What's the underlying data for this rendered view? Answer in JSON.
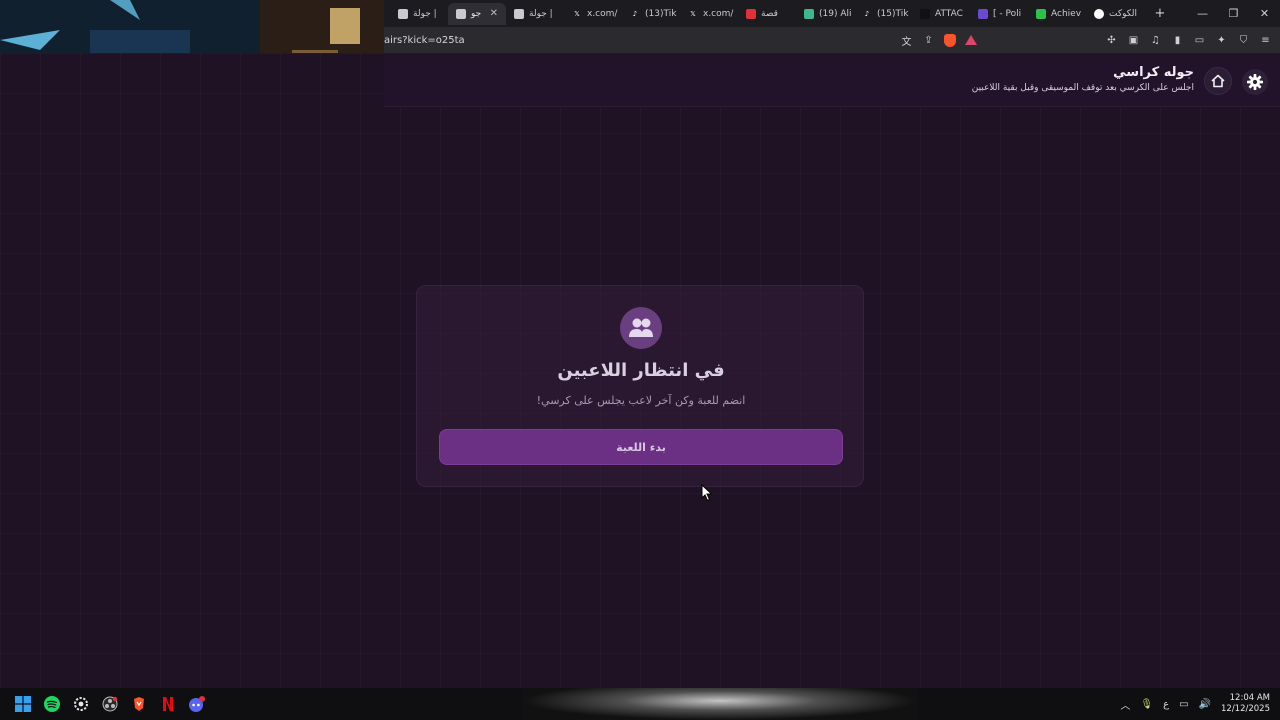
{
  "browser": {
    "tabs": [
      {
        "label": "جولة |",
        "fav_color": "#c9c9cf",
        "active": false
      },
      {
        "label": "جو",
        "fav_color": "#c9c9cf",
        "active": true
      },
      {
        "label": "جولة |",
        "fav_color": "#c9c9cf",
        "active": false
      },
      {
        "label": "x.com/",
        "fav_color": "#ffffff",
        "active": false
      },
      {
        "label": "(13)Tik",
        "fav_color": "#ffffff",
        "active": false
      },
      {
        "label": "x.com/",
        "fav_color": "#ffffff",
        "active": false
      },
      {
        "label": "قصة",
        "fav_color": "#e0303a",
        "active": false
      },
      {
        "label": "(19) Ali",
        "fav_color": "#3fb68b",
        "active": false
      },
      {
        "label": "(15)Tik",
        "fav_color": "#ffffff",
        "active": false
      },
      {
        "label": "ATTAC",
        "fav_color": "#111111",
        "active": false
      },
      {
        "label": "[ - Poli",
        "fav_color": "#6a4ad0",
        "active": false
      },
      {
        "label": "Achiev",
        "fav_color": "#2ec14b",
        "active": false
      },
      {
        "label": "الكوكت",
        "fav_color": "#ffffff",
        "active": false
      }
    ],
    "new_tab_symbol": "+",
    "url": "airs?kick=o25ta"
  },
  "header": {
    "title": "جوله كراسي",
    "subtitle": "اجلس على الكرسي بعد توقف الموسيقى وقبل بقية اللاعبين"
  },
  "card": {
    "title": "في انتظار اللاعبين",
    "subtitle": "انضم للعبة وكن آخر لاعب يجلس على كرسي!",
    "button_label": "بدء اللعبة"
  },
  "taskbar": {
    "input_lang": "ع",
    "time": "12:04 AM",
    "date": "12/12/2025"
  },
  "colors": {
    "accent": "#6b2f83",
    "page_bg": "#1f1224"
  }
}
